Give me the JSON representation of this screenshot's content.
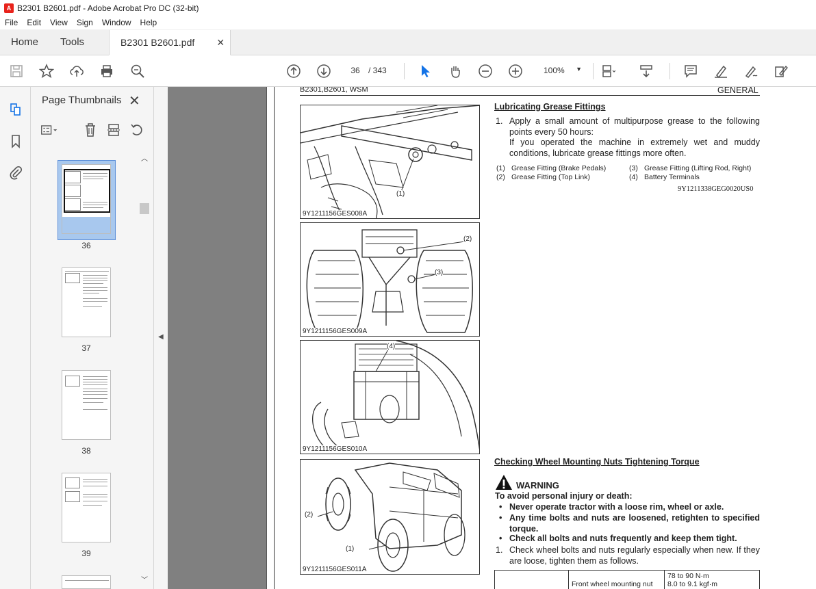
{
  "window": {
    "title": "B2301 B2601.pdf - Adobe Acrobat Pro DC (32-bit)"
  },
  "menu": [
    "File",
    "Edit",
    "View",
    "Sign",
    "Window",
    "Help"
  ],
  "tabs": {
    "home": "Home",
    "tools": "Tools",
    "document": "B2301 B2601.pdf"
  },
  "toolbar": {
    "current_page": "36",
    "total_pages": "/ 343",
    "zoom": "100%"
  },
  "thumbnails_panel": {
    "title": "Page Thumbnails",
    "pages": [
      "36",
      "37",
      "38",
      "39"
    ]
  },
  "page": {
    "header_left": "B2301,B2601, WSM",
    "header_right": "GENERAL",
    "figures": [
      {
        "caption": "9Y1211156GES008A",
        "callouts": [
          "(1)"
        ]
      },
      {
        "caption": "9Y1211156GES009A",
        "callouts": [
          "(2)",
          "(3)"
        ]
      },
      {
        "caption": "9Y1211156GES010A",
        "callouts": [
          "(4)"
        ]
      },
      {
        "caption": "9Y1211156GES011A",
        "callouts": [
          "(2)",
          "(1)"
        ]
      }
    ],
    "grease": {
      "title": "Lubricating Grease Fittings",
      "step_num": "1.",
      "step_text": "Apply a small amount of multipurpose grease to the following points every 50 hours:",
      "step_note": "If you operated the machine in extremely wet and muddy conditions, lubricate grease fittings more often.",
      "legend": [
        {
          "num": "(1)",
          "text": "Grease Fitting (Brake Pedals)"
        },
        {
          "num": "(2)",
          "text": "Grease Fitting (Top Link)"
        },
        {
          "num": "(3)",
          "text": "Grease Fitting (Lifting Rod, Right)"
        },
        {
          "num": "(4)",
          "text": "Battery Terminals"
        }
      ],
      "code": "9Y1211338GEG0020US0"
    },
    "wheel": {
      "title": "Checking Wheel Mounting Nuts Tightening Torque",
      "warning_label": "WARNING",
      "warning_lead": "To avoid personal injury or death:",
      "bullets": [
        "Never operate tractor with a loose rim, wheel or axle.",
        "Any time bolts and nuts are loosened, retighten to specified torque.",
        "Check all bolts and nuts frequently and keep them tight."
      ],
      "step_num": "1.",
      "step_text": "Check wheel bolts and nuts regularly especially when new. If they are loose, tighten them as follows.",
      "table": {
        "item": "Front wheel mounting nut",
        "value_1": "78 to 90 N·m",
        "value_2": "8.0 to 9.1 kgf·m"
      }
    }
  }
}
